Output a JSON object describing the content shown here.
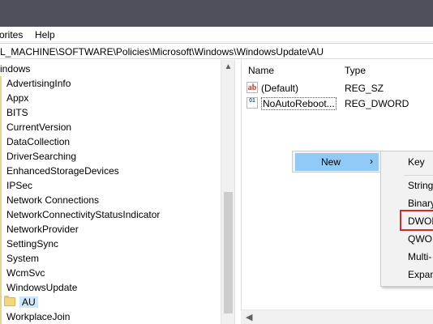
{
  "menu": {
    "favorites": "orites",
    "help": "Help"
  },
  "address": {
    "path": "L_MACHINE\\SOFTWARE\\Policies\\Microsoft\\Windows\\WindowsUpdate\\AU"
  },
  "tree": {
    "parent": "indows",
    "items": [
      "AdvertisingInfo",
      "Appx",
      "BITS",
      "CurrentVersion",
      "DataCollection",
      "DriverSearching",
      "EnhancedStorageDevices",
      "IPSec",
      "Network Connections",
      "NetworkConnectivityStatusIndicator",
      "NetworkProvider",
      "SettingSync",
      "System",
      "WcmSvc",
      "WindowsUpdate"
    ],
    "selected": "AU",
    "after": "WorkplaceJoin"
  },
  "list": {
    "columns": {
      "name": "Name",
      "type": "Type"
    },
    "rows": [
      {
        "icon": "ab",
        "name": "(Default)",
        "type": "REG_SZ"
      },
      {
        "icon": "01",
        "name": "NoAutoReboot...",
        "type": "REG_DWORD"
      }
    ]
  },
  "context_menu": {
    "new_label": "New",
    "arrow": "›"
  },
  "submenu": {
    "items": [
      "Key",
      "String",
      "Binary",
      "DWORD",
      "QWORD",
      "Multi-",
      "Expan"
    ]
  },
  "colors": {
    "highlight": "#91c9f7",
    "callout": "#d4282d",
    "titlebar": "#4e5159"
  }
}
